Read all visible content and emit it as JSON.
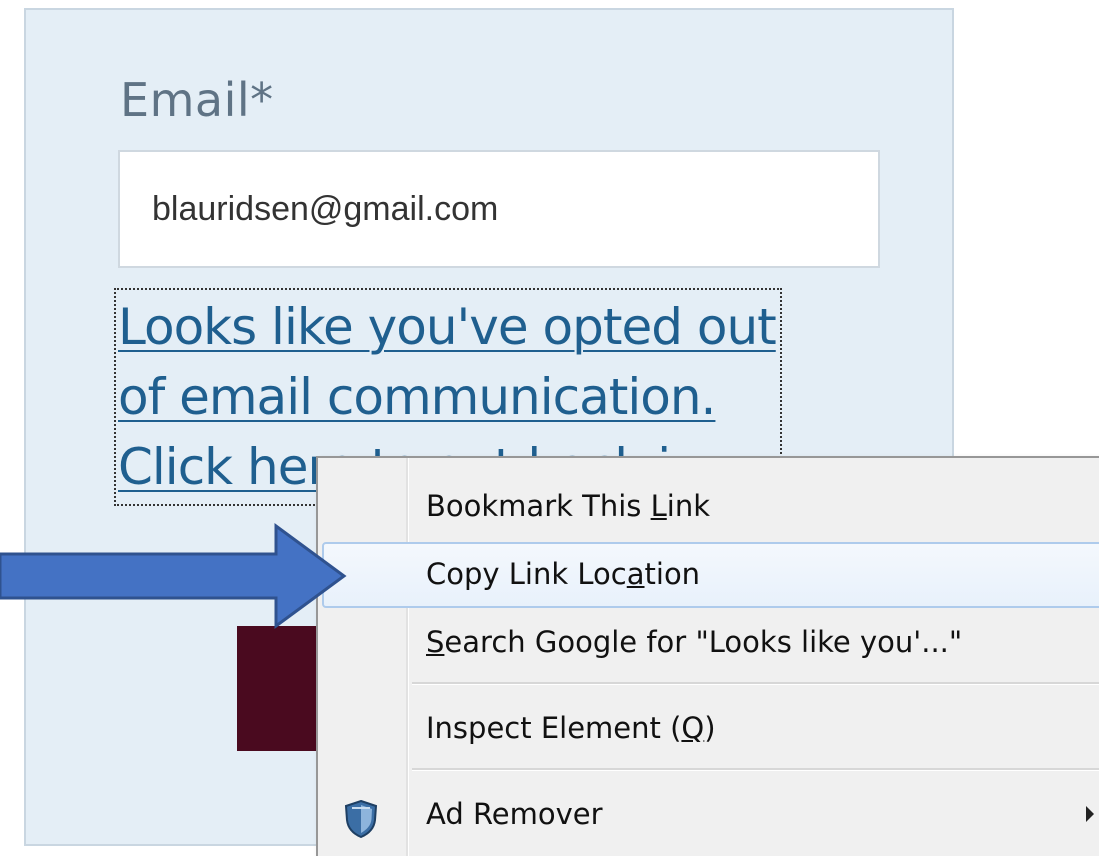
{
  "form": {
    "email_label": "Email*",
    "email_value": "blauridsen@gmail.com",
    "optout_link": "Looks like you've opted out of email communication. Click here to opt back in"
  },
  "context_menu": {
    "items": [
      {
        "pre": "Bookmark This ",
        "key": "L",
        "post": "ink"
      },
      {
        "pre": "Copy Link Loc",
        "key": "a",
        "post": "tion"
      },
      {
        "pre": "",
        "key": "S",
        "post": "earch Google for \"Looks like you'...\""
      },
      {
        "pre": "Inspect Element (",
        "key": "Q",
        "post": ")"
      },
      {
        "pre": "Ad Remover",
        "key": "",
        "post": ""
      }
    ],
    "highlighted_index": 1
  },
  "icons": {
    "addon": "shield-icon",
    "submenu": "chevron-right-icon",
    "annotation": "arrow-right-icon"
  },
  "colors": {
    "panel_bg": "#e4eef6",
    "link": "#1f5f8f",
    "button": "#4a0a1f",
    "menu_bg": "#f0f0f0",
    "highlight_border": "#aecbec",
    "arrow": "#4472c4"
  }
}
